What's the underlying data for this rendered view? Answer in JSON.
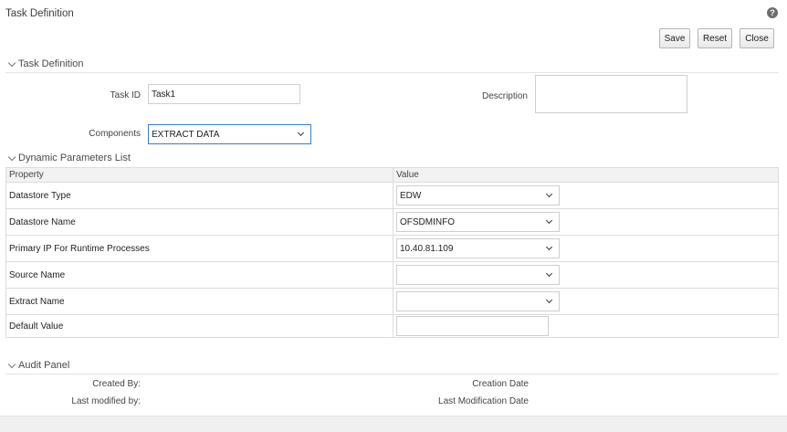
{
  "page": {
    "title": "Task Definition"
  },
  "toolbar": {
    "save_label": "Save",
    "reset_label": "Reset",
    "close_label": "Close"
  },
  "task_definition": {
    "section_title": "Task Definition",
    "task_id_label": "Task ID",
    "task_id_value": "Task1",
    "description_label": "Description",
    "components_label": "Components",
    "components_value": "EXTRACT DATA"
  },
  "dynamic_parameters": {
    "section_title": "Dynamic Parameters List",
    "columns": [
      "Property",
      "Value"
    ],
    "rows": [
      {
        "property": "Datastore Type",
        "value": "EDW",
        "kind": "select"
      },
      {
        "property": "Datastore Name",
        "value": "OFSDMINFO",
        "kind": "select"
      },
      {
        "property": "Primary IP For Runtime Processes",
        "value": "10.40.81.109",
        "kind": "select"
      },
      {
        "property": "Source Name",
        "value": "",
        "kind": "select"
      },
      {
        "property": "Extract Name",
        "value": "",
        "kind": "select"
      },
      {
        "property": "Default Value",
        "value": "",
        "kind": "text"
      }
    ]
  },
  "audit_panel": {
    "section_title": "Audit Panel",
    "created_by_label": "Created By:",
    "creation_date_label": "Creation Date",
    "last_modified_by_label": "Last modified by:",
    "last_modification_date_label": "Last Modification Date"
  },
  "icons": {
    "help": "help-icon",
    "collapse": "chevron-down-icon",
    "dropdown": "caret-down-icon"
  }
}
